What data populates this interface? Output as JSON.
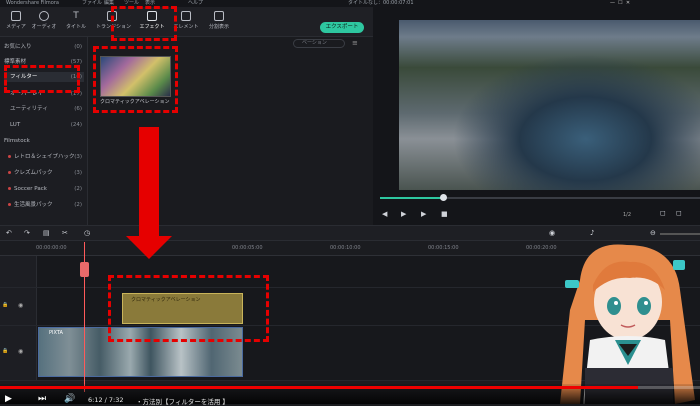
{
  "app": {
    "title": "Wondershare Filmora",
    "window_title": "タイトルなし：00:00:07:01",
    "menus": [
      "ファイル",
      "編集",
      "ツール",
      "表示",
      "ヘルプ"
    ]
  },
  "toolbar": {
    "items": [
      {
        "label": "メディア",
        "icon": "media-icon"
      },
      {
        "label": "オーディオ",
        "icon": "audio-icon"
      },
      {
        "label": "タイトル",
        "icon": "title-icon"
      },
      {
        "label": "トランジション",
        "icon": "transition-icon"
      },
      {
        "label": "エフェクト",
        "icon": "effect-icon"
      },
      {
        "label": "エレメント",
        "icon": "element-icon"
      },
      {
        "label": "分割表示",
        "icon": "split-screen-icon"
      }
    ],
    "export_label": "エクスポート"
  },
  "sidebar": {
    "items": [
      {
        "label": "お気に入り",
        "count": "(0)"
      },
      {
        "label": "標準素材",
        "count": "(57)"
      },
      {
        "label": "フィルター",
        "count": "(16)"
      },
      {
        "label": "オーバーレイ",
        "count": "(17)"
      },
      {
        "label": "ユーティリティ",
        "count": "(6)"
      },
      {
        "label": "LUT",
        "count": "(24)"
      },
      {
        "label": "Filmstock",
        "count": ""
      },
      {
        "label": "レトロ＆シェイプハック",
        "count": "(3)"
      },
      {
        "label": "クレズムパック",
        "count": "(3)"
      },
      {
        "label": "Soccer Pack",
        "count": "(2)"
      },
      {
        "label": "生活風景パック",
        "count": "(2)"
      }
    ]
  },
  "media": {
    "search_placeholder": "ベーション",
    "thumb_label": "クロマティックアベレーション"
  },
  "preview": {
    "page": "1/2"
  },
  "timeline": {
    "ticks": [
      "00:00:00:00",
      "00:00:05:00",
      "00:00:10:00",
      "00:00:15:00",
      "00:00:20:00"
    ],
    "effect_clip_label": "クロマティックアベレーション",
    "video_clip_label": "PIXTA"
  },
  "player": {
    "time": "6:12 / 7:32",
    "chapter": "・方法別【フィルターを活用 】"
  },
  "colors": {
    "accent": "#2ec7a0",
    "annotation": "#e60000"
  }
}
